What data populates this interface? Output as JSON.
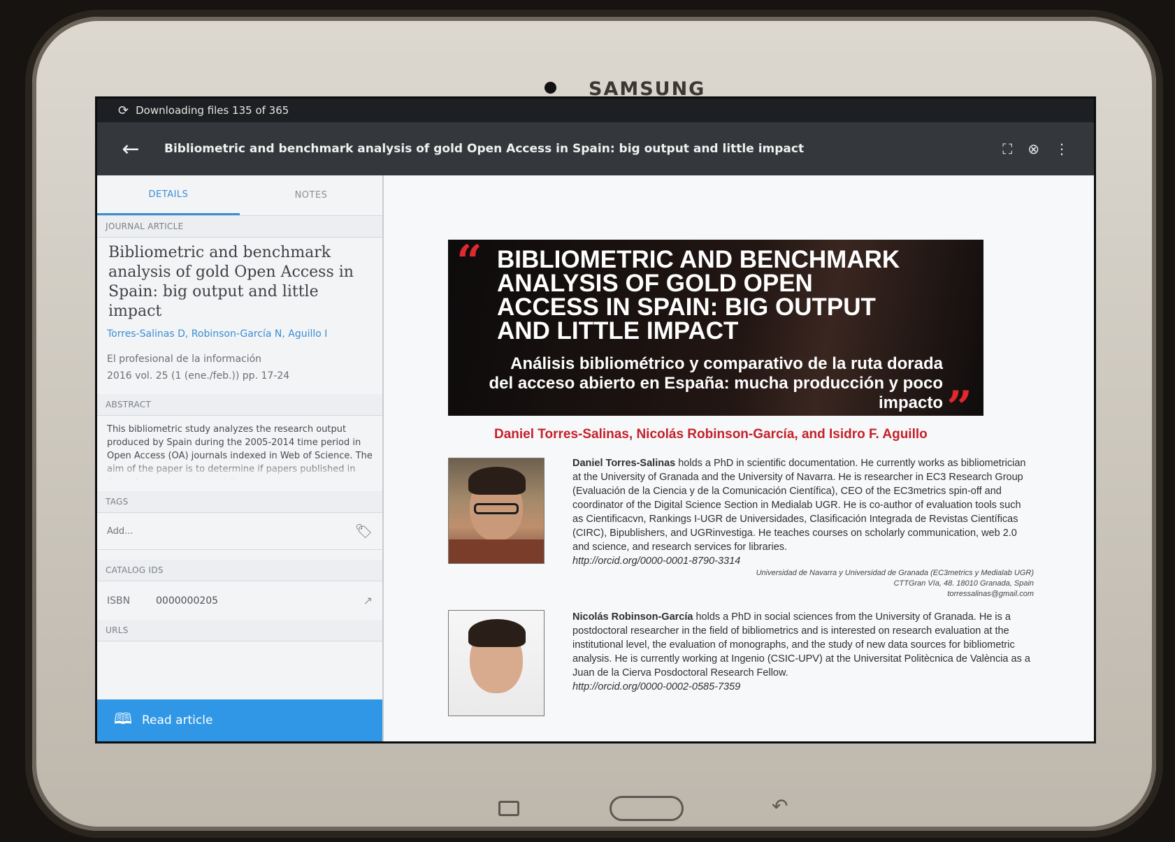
{
  "device": {
    "brand": "SAMSUNG"
  },
  "status_bar": {
    "text": "Downloading files 135 of 365"
  },
  "app_bar": {
    "title": "Bibliometric and benchmark analysis of gold Open Access in Spain: big output and little impact"
  },
  "tabs": [
    {
      "label": "DETAILS",
      "active": true
    },
    {
      "label": "NOTES",
      "active": false
    }
  ],
  "details": {
    "type_label": "JOURNAL ARTICLE",
    "title": "Bibliometric and benchmark analysis of gold Open Access in Spain: big output and little impact",
    "authors": "Torres-Salinas D, Robinson-García N, Aguillo I",
    "journal": "El profesional de la información",
    "citation": "2016 vol. 25 (1 (ene./feb.)) pp. 17-24",
    "abstract_label": "ABSTRACT",
    "abstract": "This bibliometric study analyzes the research output produced by Spain during the 2005-2014 time period in Open Access (OA) journals indexed in Web of Science. The aim of the paper is to determine if papers published in Open Access journals contribute",
    "tags_label": "TAGS",
    "tags_placeholder": "Add...",
    "catalog_label": "CATALOG IDS",
    "catalog": {
      "key": "ISBN",
      "value": "0000000205"
    },
    "urls_label": "URLS",
    "read_button": "Read article"
  },
  "reader": {
    "banner_title": "BIBLIOMETRIC AND BENCHMARK ANALYSIS OF GOLD OPEN ACCESS IN SPAIN: BIG OUTPUT AND LITTLE IMPACT",
    "banner_subtitle": "Análisis bibliométrico y comparativo de la ruta dorada del acceso abierto en España: mucha producción y poco impacto",
    "authors_line": "Daniel Torres-Salinas, Nicolás Robinson-García, and Isidro F. Aguillo",
    "bio1_name": "Daniel Torres-Salinas",
    "bio1_text": " holds a PhD in scientific documentation. He currently works as bibliometrician at the University of Granada and the University of Navarra. He is researcher in EC3 Research Group (Evaluación de la Ciencia y de la Comunicación Científica), CEO of the EC3metrics spin-off and coordinator of the Digital Science Section in Medialab UGR. He is co-author of evaluation tools such as Cientificacvn, Rankings I-UGR de Universidades, Clasificación Integrada de Revistas Científicas (CIRC), Bipublishers, and UGRinvestiga. He teaches courses on scholarly communication, web 2.0 and science, and research services for libraries.",
    "bio1_orcid": "http://orcid.org/0000-0001-8790-3314",
    "bio1_affil_1": "Universidad de Navarra y Universidad de Granada (EC3metrics y Medialab UGR)",
    "bio1_affil_2": "CTTGran Vía, 48. 18010 Granada, Spain",
    "bio1_affil_3": "torressalinas@gmail.com",
    "bio2_name": "Nicolás Robinson-García",
    "bio2_text": " holds a PhD in social sciences from the University of Granada. He is a postdoctoral researcher in the field of bibliometrics and is interested on research evaluation at the institutional level, the evaluation of monographs, and the study of new data sources for bibliometric analysis. He is currently working at Ingenio (CSIC-UPV) at the Universitat Politècnica de València as a Juan de la Cierva Posdoctoral Research Fellow.",
    "bio2_orcid": "http://orcid.org/0000-0002-0585-7359"
  }
}
